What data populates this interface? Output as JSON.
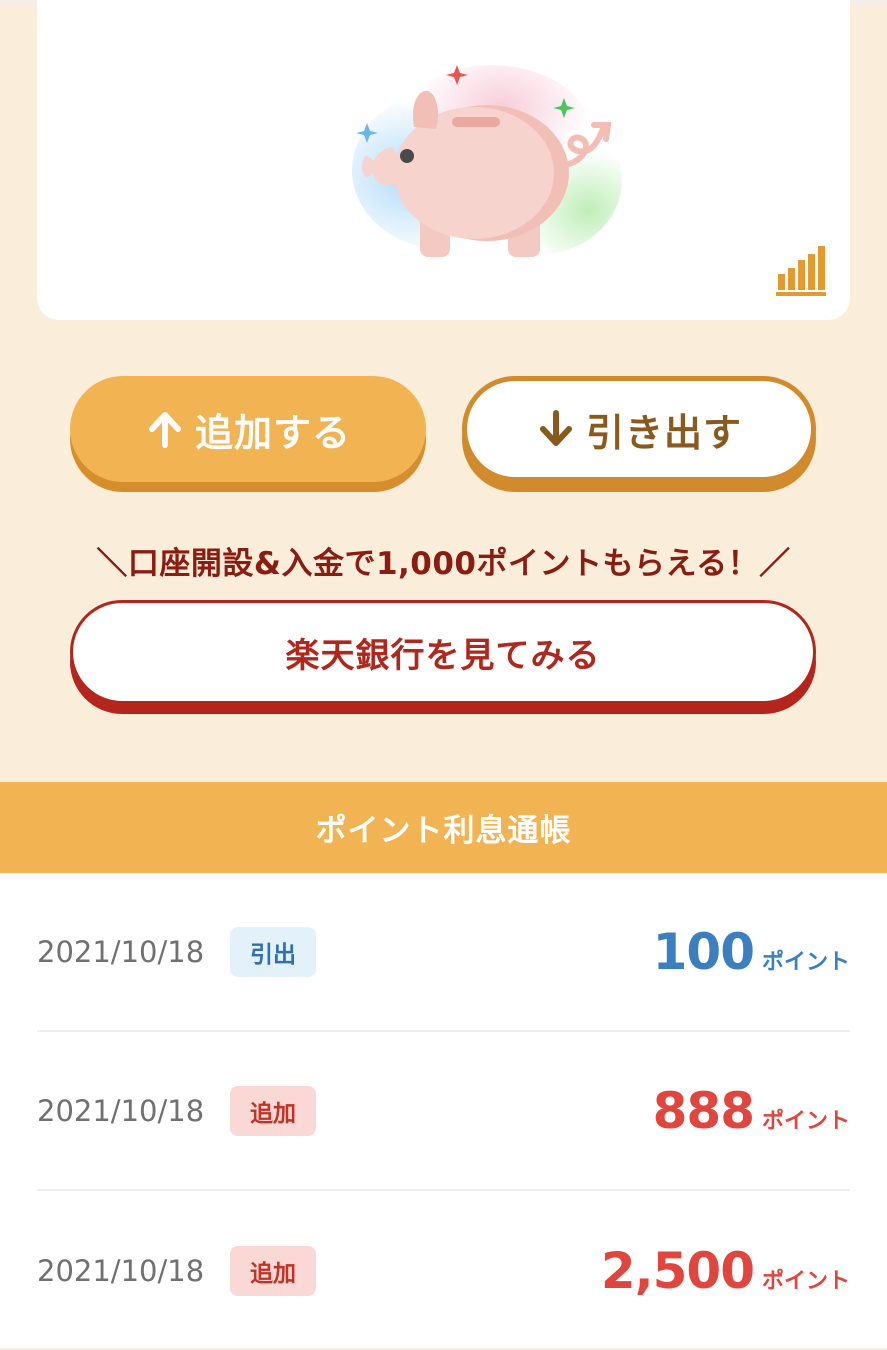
{
  "actions": {
    "add_label": "追加する",
    "withdraw_label": "引き出す"
  },
  "promo": {
    "text": "＼口座開設&入金で1,000ポイントもらえる！／",
    "button_label": "楽天銀行を見てみる"
  },
  "passbook": {
    "title": "ポイント利息通帳",
    "unit_label": "ポイント",
    "entries": [
      {
        "date": "2021/10/18",
        "type": "引出",
        "amount": "100"
      },
      {
        "date": "2021/10/18",
        "type": "追加",
        "amount": "888"
      },
      {
        "date": "2021/10/18",
        "type": "追加",
        "amount": "2,500"
      }
    ]
  },
  "colors": {
    "accent": "#f2b352",
    "withdraw": "#3b7fc1",
    "add": "#e0463d",
    "bank": "#b4261d"
  },
  "icons": {
    "hero": "piggy-bank-icon",
    "chart": "bar-chart-icon",
    "add": "arrow-up-icon",
    "withdraw": "arrow-down-icon"
  }
}
